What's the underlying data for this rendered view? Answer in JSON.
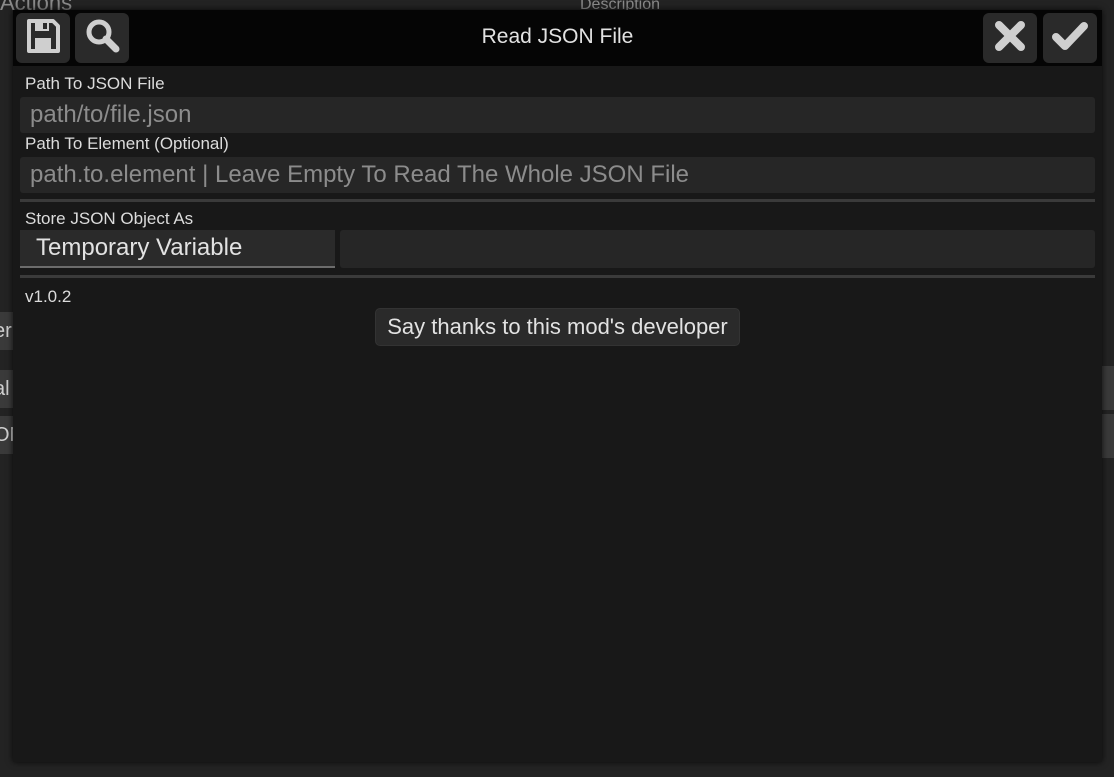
{
  "background": {
    "actions_label": "Actions",
    "description_label": "Description",
    "fragments": [
      "er",
      "al",
      "ON"
    ]
  },
  "dialog": {
    "title": "Read JSON File",
    "toolbar": {
      "save_icon": "floppy-disk-icon",
      "search_icon": "magnifier-icon",
      "cancel_icon": "x-icon",
      "confirm_icon": "checkmark-icon"
    },
    "json_path": {
      "label": "Path To JSON File",
      "value": "",
      "placeholder": "path/to/file.json"
    },
    "element_path": {
      "label": "Path To Element (Optional)",
      "value": "",
      "placeholder": "path.to.element | Leave Empty To Read The Whole JSON File"
    },
    "store_as": {
      "label": "Store JSON Object As",
      "selected": "Temporary Variable",
      "variable_name": ""
    },
    "version": "v1.0.2",
    "thanks_button": "Say thanks to this mod's developer"
  },
  "colors": {
    "dialog_bg": "#181818",
    "titlebar_bg": "#050505",
    "button_bg": "#2a2a2a",
    "input_bg": "#262626",
    "icon_color": "#cfcfcf"
  }
}
